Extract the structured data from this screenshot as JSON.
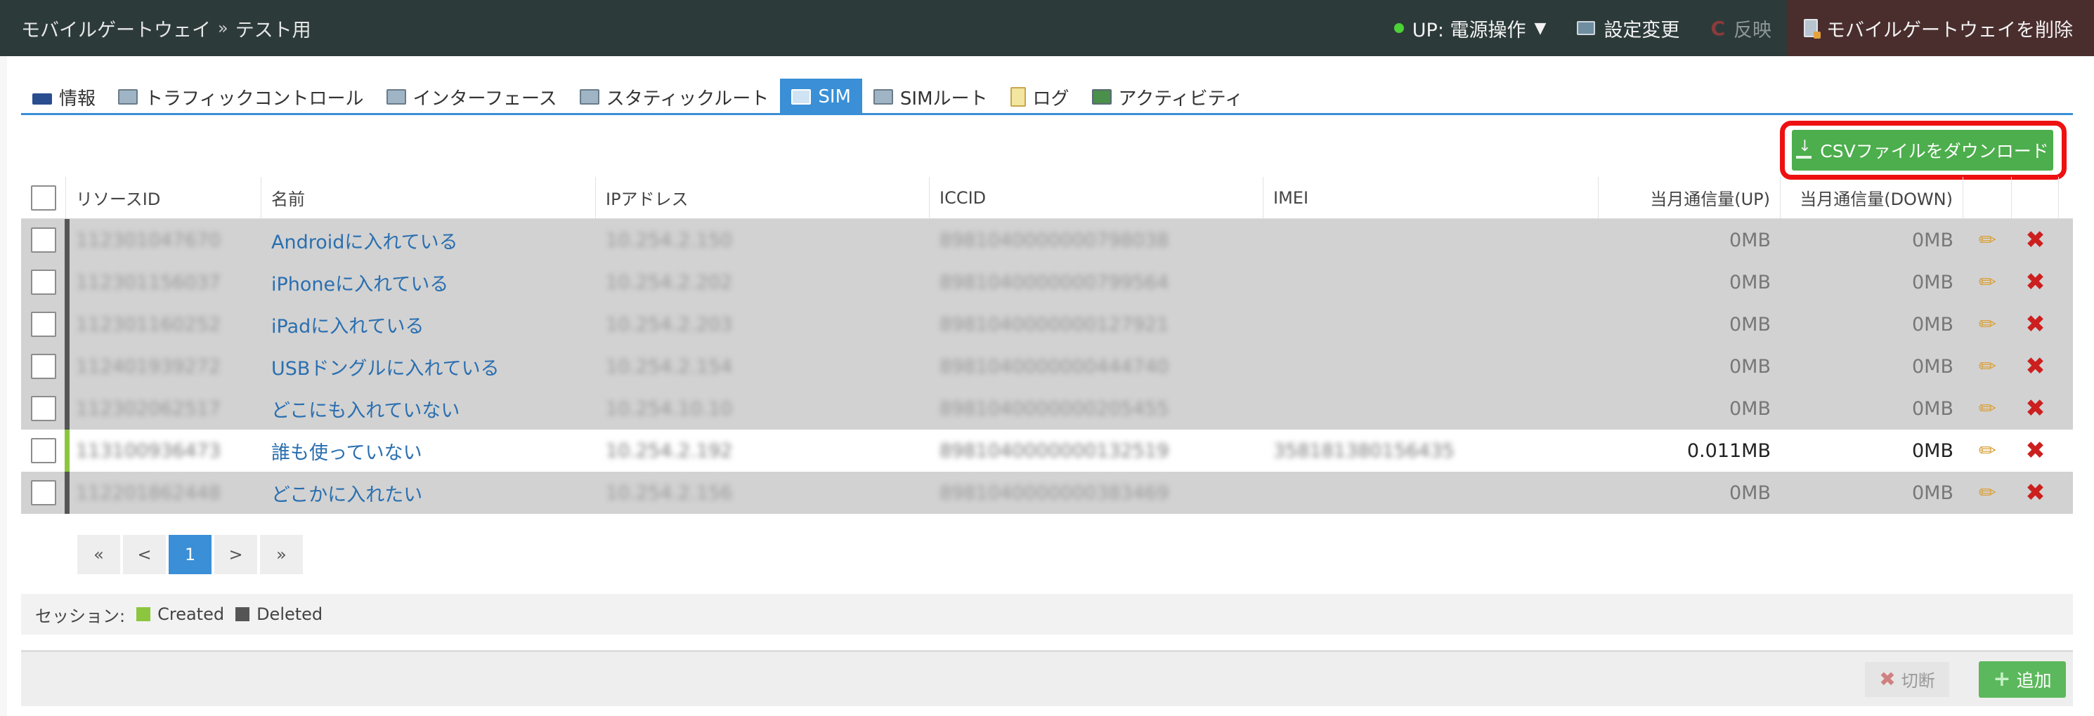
{
  "header": {
    "breadcrumb": [
      "モバイルゲートウェイ",
      "»",
      "テスト用"
    ],
    "power_status": "UP: 電源操作",
    "power_caret": "▼",
    "settings_label": "設定変更",
    "apply_label": "反映",
    "delete_label": "モバイルゲートウェイを削除",
    "refresh_glyph": "C"
  },
  "tabs": [
    {
      "label": "情報",
      "active": false
    },
    {
      "label": "トラフィックコントロール",
      "active": false
    },
    {
      "label": "インターフェース",
      "active": false
    },
    {
      "label": "スタティックルート",
      "active": false
    },
    {
      "label": "SIM",
      "active": true
    },
    {
      "label": "SIMルート",
      "active": false
    },
    {
      "label": "ログ",
      "active": false
    },
    {
      "label": "アクティビティ",
      "active": false
    }
  ],
  "csv_button": {
    "label": "CSVファイルをダウンロード"
  },
  "table": {
    "columns": [
      "リソースID",
      "名前",
      "IPアドレス",
      "ICCID",
      "IMEI",
      "当月通信量(UP)",
      "当月通信量(DOWN)"
    ],
    "rows": [
      {
        "resource_id": "112301047670",
        "name": "Androidに入れている",
        "ip": "10.254.2.150",
        "iccid": "8981040000000798038",
        "imei": "",
        "up": "0MB",
        "down": "0MB",
        "state": "deleted"
      },
      {
        "resource_id": "112301156037",
        "name": "iPhoneに入れている",
        "ip": "10.254.2.202",
        "iccid": "8981040000000799564",
        "imei": "",
        "up": "0MB",
        "down": "0MB",
        "state": "deleted"
      },
      {
        "resource_id": "112301160252",
        "name": "iPadに入れている",
        "ip": "10.254.2.203",
        "iccid": "8981040000000127921",
        "imei": "",
        "up": "0MB",
        "down": "0MB",
        "state": "deleted"
      },
      {
        "resource_id": "112401939272",
        "name": "USBドングルに入れている",
        "ip": "10.254.2.154",
        "iccid": "8981040000000444740",
        "imei": "",
        "up": "0MB",
        "down": "0MB",
        "state": "deleted"
      },
      {
        "resource_id": "112302062517",
        "name": "どこにも入れていない",
        "ip": "10.254.10.10",
        "iccid": "8981040000000205455",
        "imei": "",
        "up": "0MB",
        "down": "0MB",
        "state": "deleted"
      },
      {
        "resource_id": "113100936473",
        "name": "誰も使っていない",
        "ip": "10.254.2.192",
        "iccid": "8981040000000132519",
        "imei": "358181380156435",
        "up": "0.011MB",
        "down": "0MB",
        "state": "created"
      },
      {
        "resource_id": "112201862448",
        "name": "どこかに入れたい",
        "ip": "10.254.2.156",
        "iccid": "8981040000000383469",
        "imei": "",
        "up": "0MB",
        "down": "0MB",
        "state": "deleted"
      }
    ]
  },
  "pagination": {
    "first": "«",
    "prev": "<",
    "current": "1",
    "next": ">",
    "last": "»"
  },
  "legend": {
    "label": "セッション:",
    "created": "Created",
    "deleted": "Deleted"
  },
  "footer": {
    "disconnect_label": "切断",
    "add_label": "追加"
  },
  "icons": {
    "edit": "pencil-icon",
    "delete": "x-icon"
  },
  "colors": {
    "topbar": "#2d3a3a",
    "accent": "#3a8fd6",
    "csv_button": "#4cae4c",
    "highlight": "#ee1111",
    "created": "#8cc63f",
    "deleted": "#555555"
  }
}
